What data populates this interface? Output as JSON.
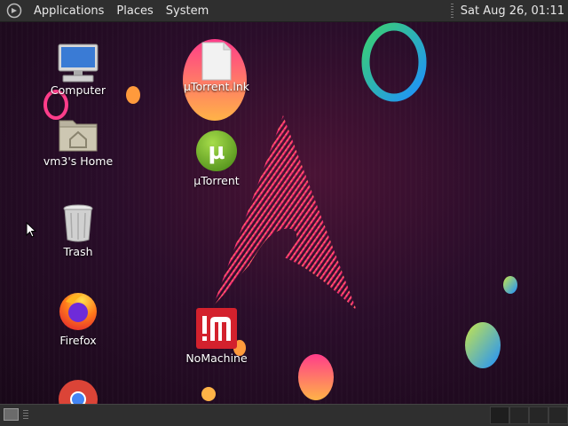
{
  "top_panel": {
    "menus": [
      "Applications",
      "Places",
      "System"
    ],
    "clock": "Sat Aug 26, 01:11"
  },
  "desktop": {
    "icons": [
      {
        "label": "Computer",
        "icon": "computer-icon"
      },
      {
        "label": "vm3's Home",
        "icon": "home-folder-icon"
      },
      {
        "label": "Trash",
        "icon": "trash-icon"
      },
      {
        "label": "Firefox",
        "icon": "firefox-icon"
      },
      {
        "label": "",
        "icon": "chrome-icon"
      },
      {
        "label": "µTorrent.lnk",
        "icon": "file-icon"
      },
      {
        "label": "µTorrent",
        "icon": "utorrent-icon"
      },
      {
        "label": "NoMachine",
        "icon": "nomachine-icon"
      }
    ]
  },
  "colors": {
    "panel": "#2f2f2f",
    "background": "#2a0d2a",
    "accent_pink": "#ff3d8a",
    "utorrent_green": "#78b82a",
    "nomachine_red": "#d3212d"
  }
}
